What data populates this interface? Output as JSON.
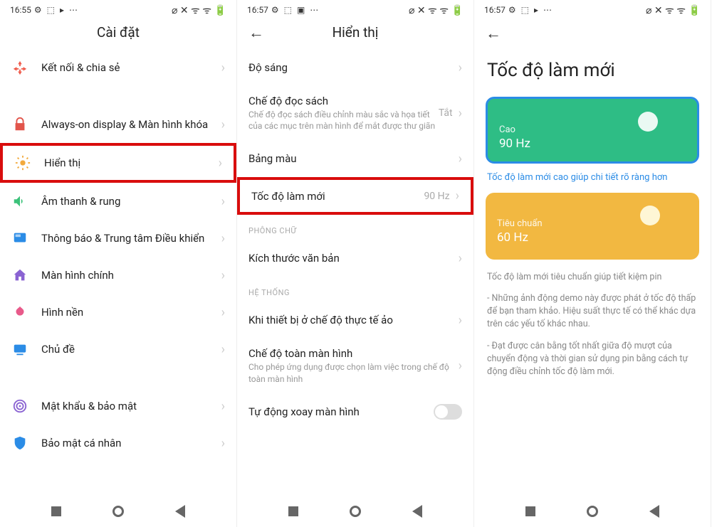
{
  "panel1": {
    "time": "16:55",
    "title": "Cài đặt",
    "items": [
      {
        "label": "Kết nối & chia sẻ",
        "icon": "connect",
        "color": "#f05a4a"
      },
      {
        "label": "Always-on display & Màn hình khóa",
        "icon": "lock",
        "color": "#e2554b"
      },
      {
        "label": "Hiển thị",
        "icon": "sun",
        "color": "#f2a93c",
        "highlight": true
      },
      {
        "label": "Âm thanh & rung",
        "icon": "sound",
        "color": "#3cc27a"
      },
      {
        "label": "Thông báo & Trung tâm Điều khiển",
        "icon": "notif",
        "color": "#2b8ce6"
      },
      {
        "label": "Màn hình chính",
        "icon": "home",
        "color": "#8a63d2"
      },
      {
        "label": "Hình nền",
        "icon": "wall",
        "color": "#e85a8a"
      },
      {
        "label": "Chủ đề",
        "icon": "theme",
        "color": "#2b8ce6"
      },
      {
        "label": "Mật khẩu & bảo mật",
        "icon": "security",
        "color": "#8a63d2"
      },
      {
        "label": "Bảo mật cá nhân",
        "icon": "privacy",
        "color": "#2b8ce6"
      }
    ]
  },
  "panel2": {
    "time": "16:57",
    "title": "Hiển thị",
    "items": [
      {
        "label": "Độ sáng"
      },
      {
        "label": "Chế độ đọc sách",
        "sub": "Chế độ đọc sách điều chỉnh màu sắc và họa tiết của các mục trên màn hình để mắt được thư giãn",
        "value": "Tắt"
      },
      {
        "label": "Bảng màu"
      },
      {
        "label": "Tốc độ làm mới",
        "value": "90 Hz",
        "highlight": true
      }
    ],
    "fontSection": "PHÔNG CHỮ",
    "fontItem": "Kích thước văn bản",
    "systemSection": "HỆ THỐNG",
    "sysItems": [
      {
        "label": "Khi thiết bị ở chế độ thực tế ảo"
      },
      {
        "label": "Chế độ toàn màn hình",
        "sub": "Cho phép ứng dụng được chọn làm việc trong chế độ toàn màn hình"
      },
      {
        "label": "Tự động xoay màn hình",
        "toggle": true
      }
    ]
  },
  "panel3": {
    "time": "16:57",
    "title": "Tốc độ làm mới",
    "options": [
      {
        "label": "Cao",
        "hz": "90 Hz",
        "selected": true,
        "hint": "Tốc độ làm mới cao giúp chi tiết rõ ràng hơn"
      },
      {
        "label": "Tiêu chuẩn",
        "hz": "60 Hz",
        "hint": "Tốc độ làm mới tiêu chuẩn giúp tiết kiệm pin"
      }
    ],
    "notes": [
      "- Những ảnh động demo này được phát ở tốc độ thấp để bạn tham khảo. Hiệu suất thực tế có thể khác dựa trên các yếu tố khác nhau.",
      "- Đạt được cân bằng tốt nhất giữa độ mượt của chuyển động và thời gian sử dụng pin bằng cách tự động điều chỉnh tốc độ làm mới."
    ]
  }
}
